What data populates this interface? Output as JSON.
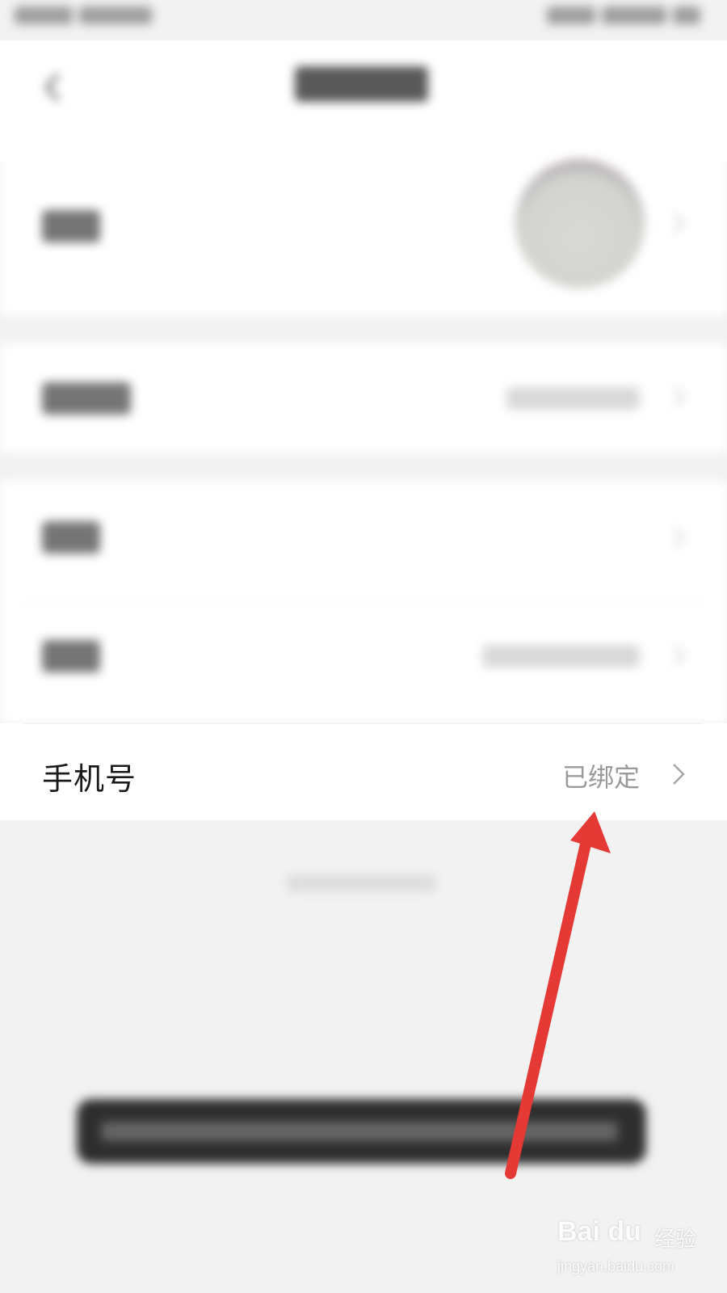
{
  "phone_row": {
    "label": "手机号",
    "value": "已绑定"
  },
  "icons": {
    "back": "chevron-left-icon",
    "row_chevron": "chevron-right-icon"
  },
  "annotation": {
    "arrow_color": "#e53935"
  },
  "watermark": {
    "logo": "Bai du",
    "text": "经验",
    "url": "jingyan.baidu.com"
  }
}
